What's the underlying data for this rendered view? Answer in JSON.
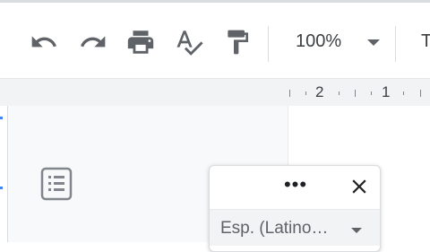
{
  "toolbar": {
    "buttons": [
      {
        "name": "undo",
        "icon": "undo-icon"
      },
      {
        "name": "redo",
        "icon": "redo-icon"
      },
      {
        "name": "print",
        "icon": "print-icon"
      },
      {
        "name": "spellcheck",
        "icon": "spellcheck-icon"
      },
      {
        "name": "paint-format",
        "icon": "paint-format-icon"
      }
    ],
    "zoom": "100%",
    "truncated_next_label": "T"
  },
  "ruler": {
    "labels": [
      "2",
      "1"
    ]
  },
  "sidebar": {
    "outline_icon": "document-outline-icon"
  },
  "popup": {
    "more_label": "•••",
    "close_icon": "close-icon",
    "language": "Esp. (Latino…"
  },
  "colors": {
    "icon": "#5f6368",
    "text": "#3c4043",
    "ruler_bg": "#f1f3f4",
    "canvas_bg": "#f8f9fa",
    "accent": "#4285f4"
  }
}
